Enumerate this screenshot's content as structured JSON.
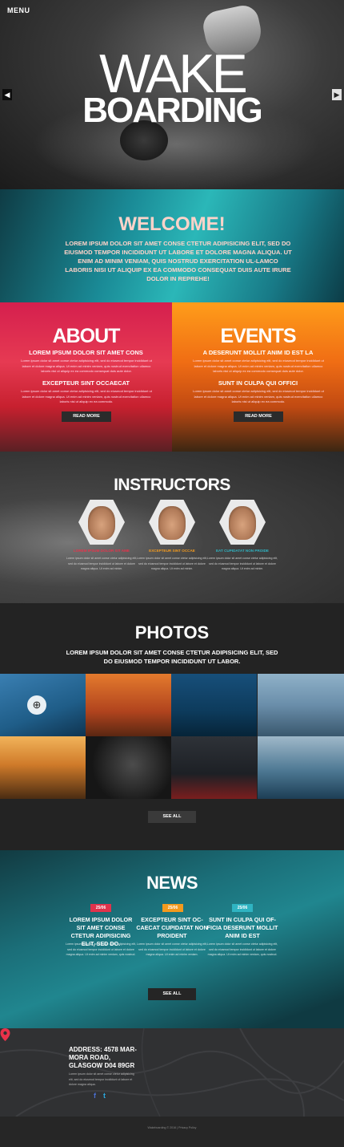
{
  "hero": {
    "menu_label": "MENU",
    "title_line1": "WAKE",
    "title_line2": "BOARDING",
    "prev_icon": "chevron-left-icon",
    "next_icon": "chevron-right-icon"
  },
  "welcome": {
    "heading": "WELCOME!",
    "text": "LOREM IPSUM DOLOR SIT AMET CONSE CTETUR ADIPISICING ELIT, SED DO EIUSMOD TEMPOR INCIDIDUNT UT LABORE ET DOLORE MAGNA ALIQUA. UT ENIM AD MINIM VENIAM, QUIS NOSTRUD EXERCITATION UL-LAMCO LABORIS NISI UT ALIQUIP EX EA COMMODO CONSEQUAT DUIS AUTE IRURE DOLOR IN REPREHE!"
  },
  "about": {
    "heading": "ABOUT",
    "sub1": "LOREM IPSUM DOLOR SIT AMET CONS",
    "text1": "Lorem ipsum dolor sit amet conse ctetur adipisicing elit, sed do eiusmod tempor incididunt ut labore et dolore magna aliqua. Ut enim ad minim veniam, quis nostrud exercitation ullamco laboris nisi ut aliquip ex ea commodo consequat duis aute dolor.",
    "sub2": "EXCEPTEUR SINT OCCAECAT",
    "text2": "Lorem ipsum dolor sit amet conse ctetur adipisicing elit, sed do eiusmod tempor incididunt ut labore et dolore magna aliqua. Ut enim ad minim veniam, quis nostrud exercitation ullamco laboris nisi ut aliquip ex ea commodo.",
    "button": "READ MORE"
  },
  "events": {
    "heading": "EVENTS",
    "sub1": "A DESERUNT MOLLIT ANIM ID EST LA",
    "text1": "Lorem ipsum dolor sit amet conse ctetur adipisicing elit, sed do eiusmod tempor incididunt ut labore et dolore magna aliqua. Ut enim ad minim veniam, quis nostrud exercitation ullamco laboris nisi ut aliquip ex ea commodo consequat duis aute dolor.",
    "sub2": "SUNT IN CULPA QUI OFFICI",
    "text2": "Lorem ipsum dolor sit amet conse ctetur adipisicing elit, sed do eiusmod tempor incididunt ut labore et dolore magna aliqua. Ut enim ad minim veniam, quis nostrud exercitation ullamco laboris nisi ut aliquip ex ea commodo.",
    "button": "READ MORE"
  },
  "instructors": {
    "heading": "INSTRUCTORS",
    "people": [
      {
        "name": "LOREM IPSUM DOLOR SIT AME",
        "color": "#e8324a",
        "desc": "Lorem ipsum dolor sit amet conse ctetur adipisicing elit, sed do eiusmod tempor incididunt ut labore et dolore magna aliqua. Ut enim ad minim."
      },
      {
        "name": "EXCEPTEUR SINT OCCAE",
        "color": "#f39a1e",
        "desc": "Lorem ipsum dolor sit amet conse ctetur adipisicing elit, sed do eiusmod tempor incididunt ut labore et dolore magna aliqua. Ut enim ad minim."
      },
      {
        "name": "EAT CUPIDATAT NON PROIDE",
        "color": "#2fb4c2",
        "desc": "Lorem ipsum dolor sit amet conse ctetur adipisicing elit, sed do eiusmod tempor incididunt ut labore et dolore magna aliqua. Ut enim ad minim."
      }
    ]
  },
  "photos": {
    "heading": "PHOTOS",
    "text": "LOREM IPSUM DOLOR SIT AMET CONSE CTETUR ADIPISICING ELIT, SED DO EIUSMOD TEMPOR INCIDIDUNT UT LABOR.",
    "zoom_icon": "zoom-in-icon",
    "button": "SEE ALL"
  },
  "news": {
    "heading": "NEWS",
    "items": [
      {
        "date": "25/06",
        "badge_color": "#e0334c",
        "title": "LOREM IPSUM DOLOR SIT AMET CONSE CTETUR ADIPISICING ELIT, SED DO.",
        "desc": "Lorem ipsum dolor sit amet conse ctetur adipisicing elit, sed do eiusmod tempor incididunt ut labore et dolore magna aliqua. Ut enim ad minim veniam, quis nostrud."
      },
      {
        "date": "25/06",
        "badge_color": "#f39a1e",
        "title": "EXCEPTEUR SINT OC-CAECAT CUPIDATAT NON PROIDENT",
        "desc": "Lorem ipsum dolor sit amet conse ctetur adipisicing elit, sed do eiusmod tempor incididunt ut labore et dolore magna aliqua. Ut enim ad minim veniam."
      },
      {
        "date": "25/06",
        "badge_color": "#2fb4c2",
        "title": "SUNT IN CULPA QUI OF-FICIA DESERUNT MOLLIT ANIM ID EST",
        "desc": "Lorem ipsum dolor sit amet conse ctetur adipisicing elit, sed do eiusmod tempor incididunt ut labore et dolore magna aliqua. Ut enim ad minim veniam, quis nostrud."
      }
    ],
    "button": "SEE ALL"
  },
  "contact": {
    "address": "ADDRESS: 4578 MAR-MORA ROAD, GLASGOW D04 89GR",
    "text": "Lorem ipsum dolor sit amet conse ctetur adipisicing elit, sed do eiusmod tempor incididunt ut labore et dolore magna aliqua.",
    "facebook": "f",
    "twitter": "t",
    "pin_color": "#e8324a"
  },
  "footer": {
    "text": "Wakeboarding © 2016  |  Privacy Policy"
  }
}
